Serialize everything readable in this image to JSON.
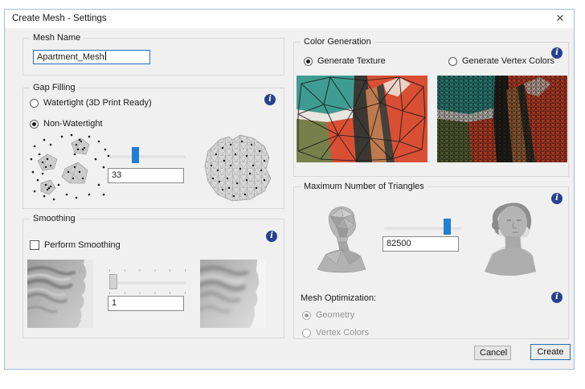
{
  "window": {
    "title": "Create Mesh - Settings",
    "close_icon": "✕"
  },
  "mesh_name": {
    "group_label": "Mesh Name",
    "value": "Apartment_Mesh"
  },
  "gap_filling": {
    "group_label": "Gap Filling",
    "option_watertight": "Watertight (3D Print Ready)",
    "option_non_watertight": "Non-Watertight",
    "selected_option": "Non-Watertight",
    "value": "33"
  },
  "smoothing": {
    "group_label": "Smoothing",
    "checkbox_label": "Perform Smoothing",
    "checked": false,
    "value": "1"
  },
  "color_generation": {
    "group_label": "Color Generation",
    "option_texture": "Generate Texture",
    "option_vertex": "Generate Vertex Colors",
    "selected_option": "Generate Texture"
  },
  "max_triangles": {
    "group_label": "Maximum Number of Triangles",
    "value": "82500"
  },
  "mesh_optimization": {
    "label": "Mesh Optimization:",
    "option_geometry": "Geometry",
    "option_vertex_colors": "Vertex Colors",
    "selected_option": "Geometry",
    "enabled": false
  },
  "actions": {
    "cancel_label": "Cancel",
    "create_label": "Create"
  },
  "info_icon_glyph": "i",
  "colors": {
    "accent_blue": "#1f7fd4",
    "dialog_border": "#9dbfdd",
    "info_icon_blue": "#28418f",
    "focus_border": "#2a6dbd"
  }
}
